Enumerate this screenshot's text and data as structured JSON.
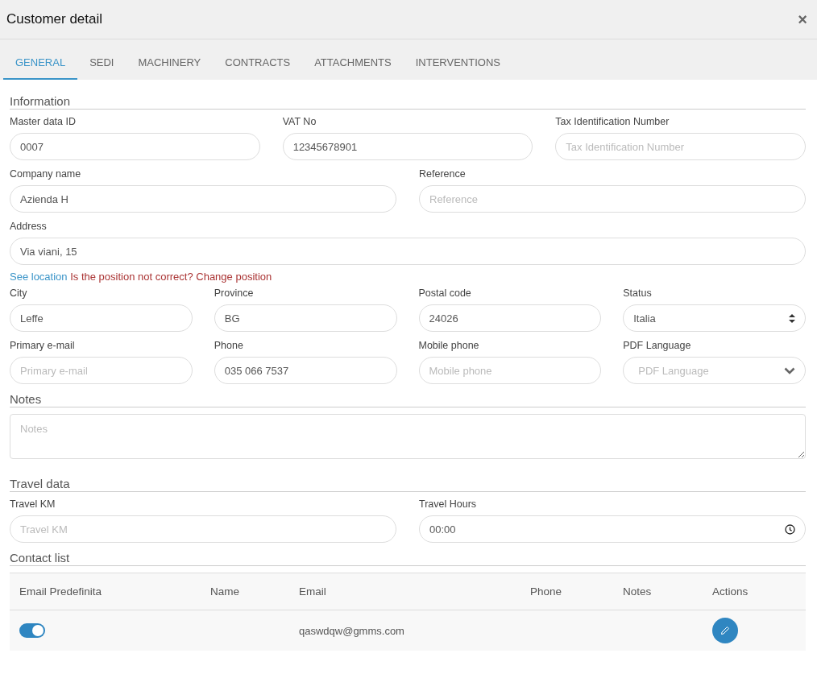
{
  "window": {
    "title": "Customer detail",
    "close": "×"
  },
  "tabs": [
    {
      "label": "GENERAL",
      "selected": true
    },
    {
      "label": "SEDI",
      "selected": false
    },
    {
      "label": "MACHINERY",
      "selected": false
    },
    {
      "label": "CONTRACTS",
      "selected": false
    },
    {
      "label": "ATTACHMENTS",
      "selected": false
    },
    {
      "label": "INTERVENTIONS",
      "selected": false
    }
  ],
  "information": {
    "title": "Information",
    "rows_top": [
      [
        {
          "label": "Master data ID",
          "value": "0007",
          "kind": "text"
        },
        {
          "label": "VAT No",
          "value": "12345678901",
          "kind": "text"
        },
        {
          "label": "Tax Identification Number",
          "placeholder": "Tax Identification Number",
          "kind": "text"
        }
      ],
      [
        {
          "label": "Company name",
          "value": "Azienda H",
          "kind": "text"
        },
        {
          "label": "Reference",
          "placeholder": "Reference",
          "kind": "text"
        }
      ],
      [
        {
          "label": "Address",
          "value": "Via viani, 15",
          "kind": "text"
        }
      ]
    ],
    "location": {
      "link": "See location",
      "question": "Is the position not correct? Change position"
    },
    "rows_bottom": [
      [
        {
          "label": "City",
          "value": "Leffe",
          "kind": "text"
        },
        {
          "label": "Province",
          "value": "BG",
          "kind": "text"
        },
        {
          "label": "Postal code",
          "value": "24026",
          "kind": "text"
        },
        {
          "label": "Status",
          "value": "Italia",
          "kind": "select"
        }
      ],
      [
        {
          "label": "Primary e-mail",
          "placeholder": "Primary e-mail",
          "kind": "text"
        },
        {
          "label": "Phone",
          "value": "035 066 7537",
          "kind": "text"
        },
        {
          "label": "Mobile phone",
          "placeholder": "Mobile phone",
          "kind": "text"
        },
        {
          "label": "PDF Language",
          "placeholder": "PDF Language",
          "kind": "dropdown"
        }
      ]
    ]
  },
  "notes": {
    "title": "Notes",
    "placeholder": "Notes"
  },
  "travel": {
    "title": "Travel data",
    "fields": [
      {
        "label": "Travel KM",
        "placeholder": "Travel KM",
        "kind": "text"
      },
      {
        "label": "Travel Hours",
        "value": "00:00",
        "kind": "time"
      }
    ]
  },
  "contacts": {
    "title": "Contact list",
    "columns": [
      "Email Predefinita",
      "Name",
      "Email",
      "Phone",
      "Notes",
      "Actions"
    ],
    "rows": [
      {
        "default_email": true,
        "email": "qaswdqw@gmms.com"
      }
    ]
  }
}
